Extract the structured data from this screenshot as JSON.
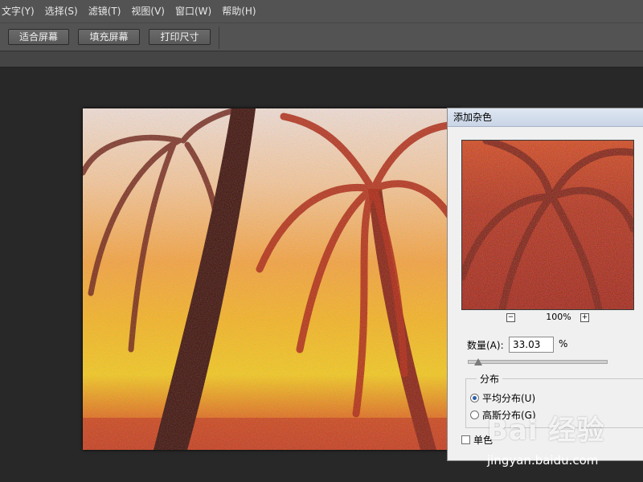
{
  "menubar": {
    "items": [
      "文字(Y)",
      "选择(S)",
      "滤镜(T)",
      "视图(V)",
      "窗口(W)",
      "帮助(H)"
    ]
  },
  "toolbar": {
    "buttons": [
      "适合屏幕",
      "填充屏幕",
      "打印尺寸"
    ]
  },
  "dialog": {
    "title": "添加杂色",
    "zoom_value": "100%",
    "zoom_out_symbol": "−",
    "zoom_in_symbol": "+",
    "amount_label": "数量(A):",
    "amount_value": "33.03",
    "amount_unit": "%",
    "amount_level_percent": 33.03,
    "distribution_title": "分布",
    "distribution_options": [
      {
        "label": "平均分布(U)",
        "selected": true
      },
      {
        "label": "高斯分布(G)",
        "selected": false
      }
    ],
    "monochrome_label": "单色",
    "monochrome_checked": false
  },
  "watermark": {
    "logo_text": "Bai 经验",
    "url": "jingyan.baidu.com"
  },
  "colors": {
    "ui_gray": "#535353",
    "canvas": "#282828",
    "dialog_bg": "#f0f0f0"
  }
}
